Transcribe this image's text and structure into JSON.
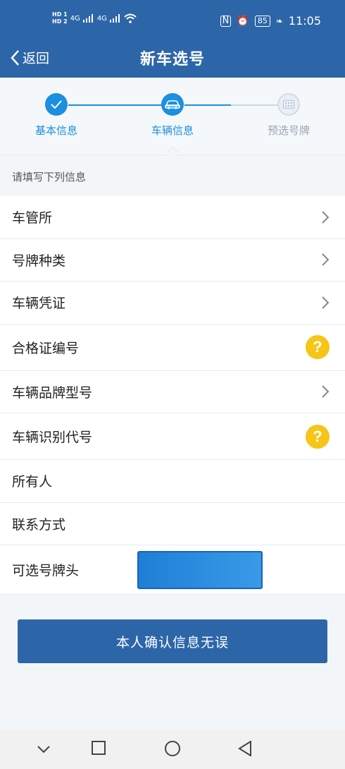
{
  "status": {
    "time": "11:05",
    "battery": "85",
    "hd1": "HD 1",
    "hd2": "HD 2",
    "net1": "4G",
    "net2": "4G"
  },
  "nav": {
    "back_label": "返回",
    "title": "新车选号"
  },
  "steps": [
    {
      "label": "基本信息",
      "state": "done"
    },
    {
      "label": "车辆信息",
      "state": "active"
    },
    {
      "label": "预选号牌",
      "state": "todo"
    }
  ],
  "section_title": "请填写下列信息",
  "rows": [
    {
      "label": "车管所"
    },
    {
      "label": "号牌种类"
    },
    {
      "label": "车辆凭证"
    },
    {
      "label": "合格证编号"
    },
    {
      "label": "车辆品牌型号"
    },
    {
      "label": "车辆识别代号"
    },
    {
      "label": "所有人"
    },
    {
      "label": "联系方式"
    },
    {
      "label": "可选号牌头"
    }
  ],
  "confirm_label": "本人确认信息无误",
  "colors": {
    "header": "#2d66a8",
    "accent": "#1b8fe0",
    "help": "#f5c518"
  }
}
